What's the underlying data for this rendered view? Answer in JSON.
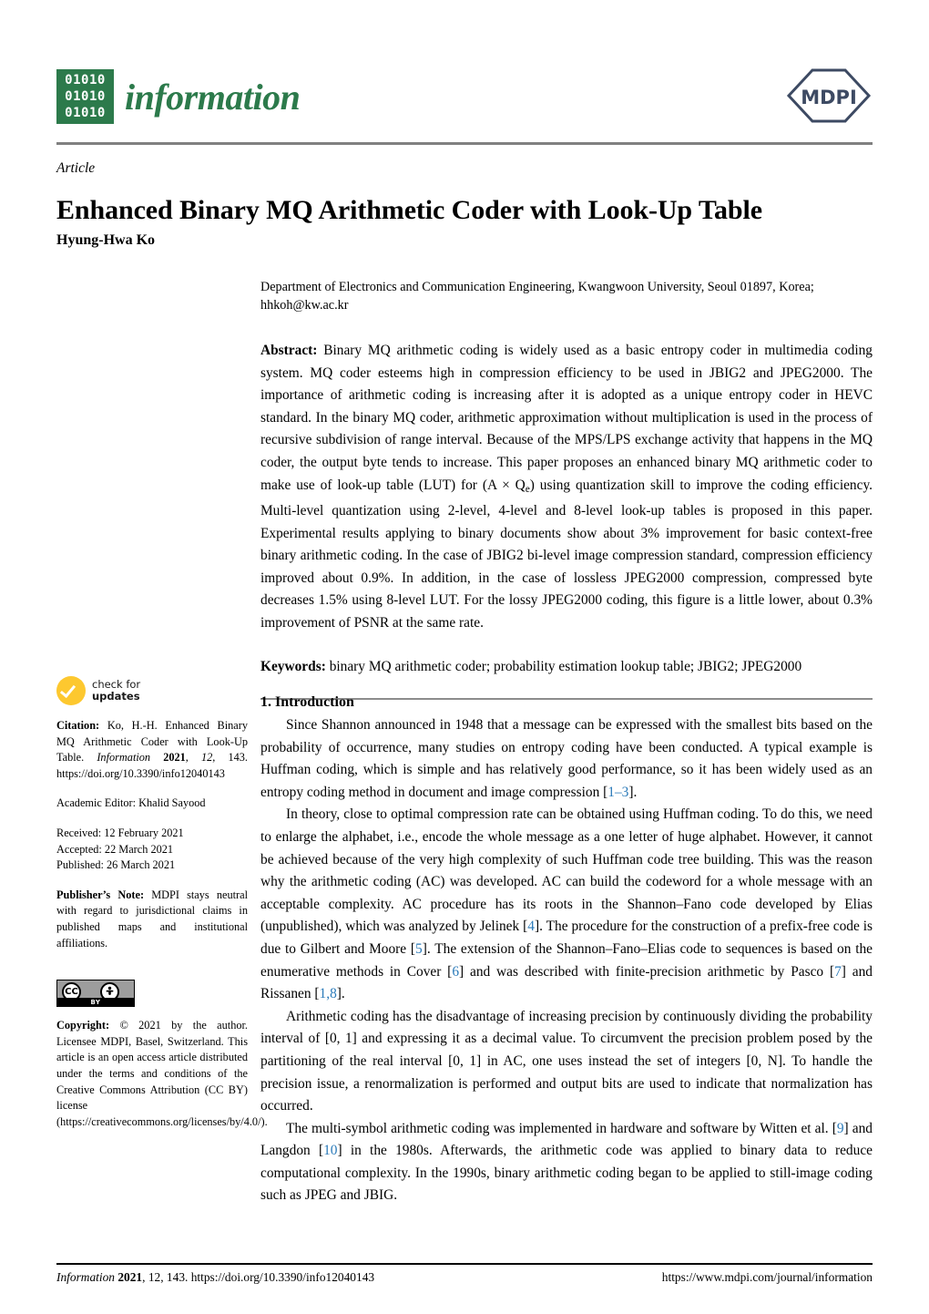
{
  "masthead": {
    "binary_rows": [
      "01010",
      "01010",
      "01010"
    ],
    "journal_name": "information",
    "publisher_logo_text": "MDPI",
    "brand_green": "#2c7a4b",
    "publisher_navy": "#3d4a63"
  },
  "header": {
    "article_type": "Article",
    "title": "Enhanced Binary MQ Arithmetic Coder with Look-Up Table",
    "authors": "Hyung-Hwa Ko"
  },
  "affiliation": {
    "line1": "Department of Electronics and Communication Engineering, Kwangwoon University, Seoul 01897, Korea;",
    "line2": "hhkoh@kw.ac.kr"
  },
  "abstract": {
    "label": "Abstract:",
    "part1": "Binary MQ arithmetic coding is widely used as a basic entropy coder in multimedia coding system. MQ coder esteems high in compression efficiency to be used in JBIG2 and JPEG2000. The importance of arithmetic coding is increasing after it is adopted as a unique entropy coder in HEVC standard. In the binary MQ coder, arithmetic approximation without multiplication is used in the process of recursive subdivision of range interval. Because of the MPS/LPS exchange activity that happens in the MQ coder, the output byte tends to increase. This paper proposes an enhanced binary MQ arithmetic coder to make use of look-up table (LUT) for (A × Q",
    "subscript": "e",
    "part2": ") using quantization skill to improve the coding efficiency. Multi-level quantization using 2-level, 4-level and 8-level look-up tables is proposed in this paper. Experimental results applying to binary documents show about 3% improvement for basic context-free binary arithmetic coding. In the case of JBIG2 bi-level image compression standard, compression efficiency improved about 0.9%. In addition, in the case of lossless JPEG2000 compression, compressed byte decreases 1.5% using 8-level LUT. For the lossy JPEG2000 coding, this figure is a little lower, about 0.3% improvement of PSNR at the same rate."
  },
  "keywords": {
    "label": "Keywords:",
    "text": "binary MQ arithmetic coder; probability estimation lookup table; JBIG2; JPEG2000"
  },
  "sidebar": {
    "updates_badge": {
      "line1": "check for",
      "line2": "updates"
    },
    "citation": {
      "label": "Citation:",
      "text_before_journal": " Ko, H.-H. Enhanced Binary MQ Arithmetic Coder with Look-Up Table. ",
      "journal": "Information",
      "year": "2021",
      "volume": "12",
      "article": "143",
      "doi": "https://doi.org/10.3390/info12040143"
    },
    "academic_editor": "Academic Editor: Khalid Sayood",
    "received": "Received: 12 February 2021",
    "accepted": "Accepted: 22 March 2021",
    "published": "Published: 26 March 2021",
    "publishers_note": {
      "label": "Publisher’s Note:",
      "text": " MDPI stays neutral with regard to jurisdictional claims in published maps and institutional affiliations."
    },
    "cc_badge": {
      "cc_glyph": "CC",
      "person_glyph": "ⓘ",
      "by_label": "BY"
    },
    "copyright": {
      "label": "Copyright:",
      "text": " © 2021 by the author. Licensee MDPI, Basel, Switzerland. This article is an open access article distributed under the terms and conditions of the Creative Commons Attribution (CC BY) license (https://creativecommons.org/licenses/by/4.0/)."
    }
  },
  "introduction": {
    "heading": "1. Introduction",
    "paragraphs": [
      {
        "segments": [
          {
            "t": "Since Shannon announced in 1948 that a message can be expressed with the smallest bits based on the probability of occurrence, many studies on entropy coding have been conducted. A typical example is Huffman coding, which is simple and has relatively good performance, so it has been widely used as an entropy coding method in document and image compression ["
          },
          {
            "t": "1–3",
            "ref": true
          },
          {
            "t": "]."
          }
        ]
      },
      {
        "segments": [
          {
            "t": "In theory, close to optimal compression rate can be obtained using Huffman coding. To do this, we need to enlarge the alphabet, i.e., encode the whole message as a one letter of huge alphabet. However, it cannot be achieved because of the very high complexity of such Huffman code tree building. This was the reason why the arithmetic coding (AC) was developed. AC can build the codeword for a whole message with an acceptable complexity. AC procedure has its roots in the Shannon–Fano code developed by Elias (unpublished), which was analyzed by Jelinek ["
          },
          {
            "t": "4",
            "ref": true
          },
          {
            "t": "]. The procedure for the construction of a prefix-free code is due to Gilbert and Moore ["
          },
          {
            "t": "5",
            "ref": true
          },
          {
            "t": "]. The extension of the Shannon–Fano–Elias code to sequences is based on the enumerative methods in Cover ["
          },
          {
            "t": "6",
            "ref": true
          },
          {
            "t": "] and was described with finite-precision arithmetic by Pasco ["
          },
          {
            "t": "7",
            "ref": true
          },
          {
            "t": "] and Rissanen ["
          },
          {
            "t": "1,8",
            "ref": true
          },
          {
            "t": "]."
          }
        ]
      },
      {
        "segments": [
          {
            "t": "Arithmetic coding has the disadvantage of increasing precision by continuously dividing the probability interval of [0, 1] and expressing it as a decimal value. To circumvent the precision problem posed by the partitioning of the real interval [0, 1] in AC, one uses instead the set of integers [0, N]. To handle the precision issue, a renormalization is performed and output bits are used to indicate that normalization has occurred."
          }
        ]
      },
      {
        "segments": [
          {
            "t": "The multi-symbol arithmetic coding was implemented in hardware and software by Witten et al. ["
          },
          {
            "t": "9",
            "ref": true
          },
          {
            "t": "] and Langdon ["
          },
          {
            "t": "10",
            "ref": true
          },
          {
            "t": "] in the 1980s. Afterwards, the arithmetic code was applied to binary data to reduce computational complexity. In the 1990s, binary arithmetic coding began to be applied to still-image coding such as JPEG and JBIG."
          }
        ]
      }
    ]
  },
  "footer": {
    "journal": "Information",
    "year": "2021",
    "volume": "12",
    "article": "143",
    "doi": "https://doi.org/10.3390/info12040143",
    "url": "https://www.mdpi.com/journal/information"
  }
}
